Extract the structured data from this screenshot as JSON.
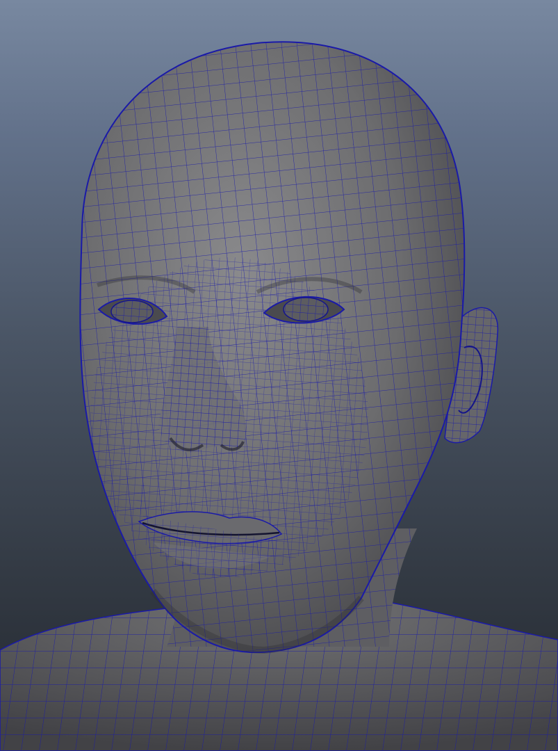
{
  "viewport": {
    "background_top": "#7888a0",
    "background_bottom": "#22272e"
  },
  "model": {
    "shading": "smooth-shaded-with-wireframe",
    "surface_color": "#6a6a6c",
    "wireframe_color": "#1a1aa8"
  }
}
